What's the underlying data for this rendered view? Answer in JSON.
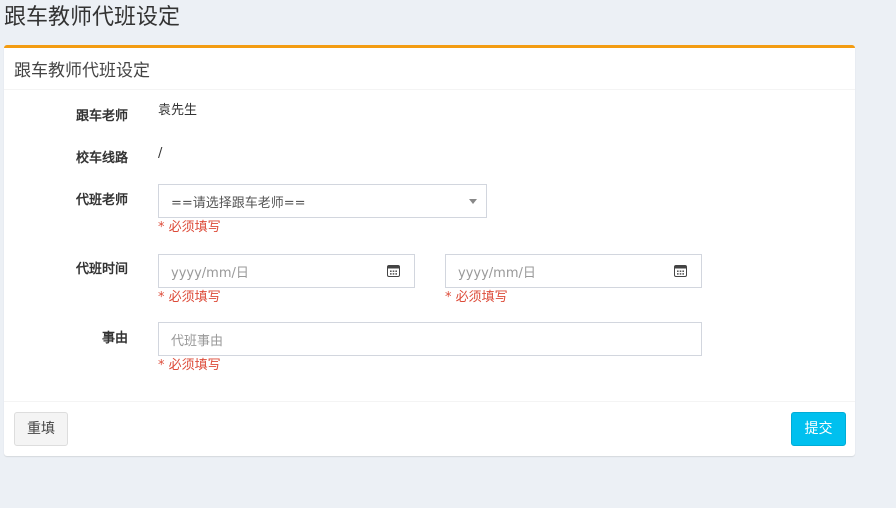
{
  "page_title": "跟车教师代班设定",
  "box_title": "跟车教师代班设定",
  "form": {
    "escort_teacher": {
      "label": "跟车老师",
      "value": "袁先生"
    },
    "bus_route": {
      "label": "校车线路",
      "value": "/"
    },
    "substitute_teacher": {
      "label": "代班老师",
      "selected": "==请选择跟车老师==",
      "required_hint": "* 必须填写"
    },
    "substitute_time": {
      "label": "代班时间",
      "start_placeholder": "yyyy/mm/日",
      "end_placeholder": "yyyy/mm/日",
      "required_hint": "* 必须填写"
    },
    "reason": {
      "label": "事由",
      "placeholder": "代班事由",
      "required_hint": "* 必须填写"
    }
  },
  "footer": {
    "reset_label": "重填",
    "submit_label": "提交"
  },
  "colors": {
    "accent": "#f39c12",
    "required": "#dd4b39",
    "submit": "#00c0ef",
    "background": "#ecf0f5"
  },
  "icons": {
    "calendar": "calendar-icon",
    "dropdown": "chevron-down-icon"
  }
}
